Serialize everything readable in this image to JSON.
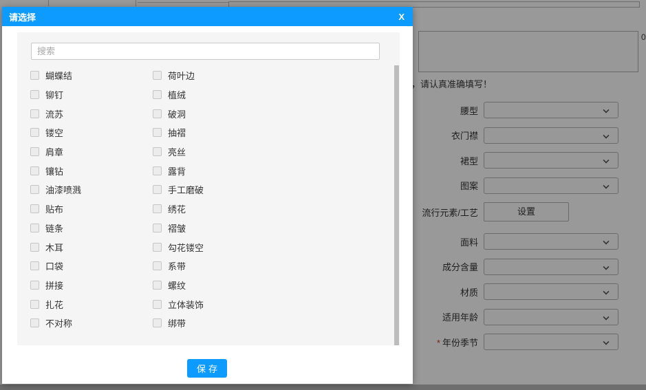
{
  "modal": {
    "title": "请选择",
    "close_label": "X",
    "search_placeholder": "搜索",
    "save_label": "保存",
    "items": [
      "蝴蝶结",
      "荷叶边",
      "铆钉",
      "植绒",
      "流苏",
      "破洞",
      "镂空",
      "抽褶",
      "肩章",
      "亮丝",
      "镶钻",
      "露背",
      "油漆喷溅",
      "手工磨破",
      "贴布",
      "绣花",
      "链条",
      "褶皱",
      "木耳",
      "勾花镂空",
      "口袋",
      "系带",
      "拼接",
      "螺纹",
      "扎花",
      "立体装饰",
      "不对称",
      "绑带"
    ]
  },
  "background": {
    "counter": "0",
    "note": "，请认真准确填写！",
    "form_fields": [
      {
        "name": "waist-type",
        "label": "腰型",
        "type": "select",
        "required": false
      },
      {
        "name": "placket",
        "label": "衣门襟",
        "type": "select",
        "required": false
      },
      {
        "name": "skirt-type",
        "label": "裙型",
        "type": "select",
        "required": false
      },
      {
        "name": "pattern",
        "label": "图案",
        "type": "select",
        "required": false
      },
      {
        "name": "trend-elements",
        "label": "流行元素/工艺",
        "type": "button",
        "button_label": "设置",
        "required": false
      },
      {
        "name": "fabric",
        "label": "面料",
        "type": "select",
        "required": false
      },
      {
        "name": "composition",
        "label": "成分含量",
        "type": "select",
        "required": false
      },
      {
        "name": "material",
        "label": "材质",
        "type": "select",
        "required": false
      },
      {
        "name": "age-range",
        "label": "适用年龄",
        "type": "select",
        "required": false
      },
      {
        "name": "year-season",
        "label": "年份季节",
        "type": "select",
        "required": true
      }
    ]
  },
  "colors": {
    "accent_blue": "#0d9bff",
    "required_red": "#d9342b",
    "overlay": "rgba(0,0,0,0.40)"
  }
}
